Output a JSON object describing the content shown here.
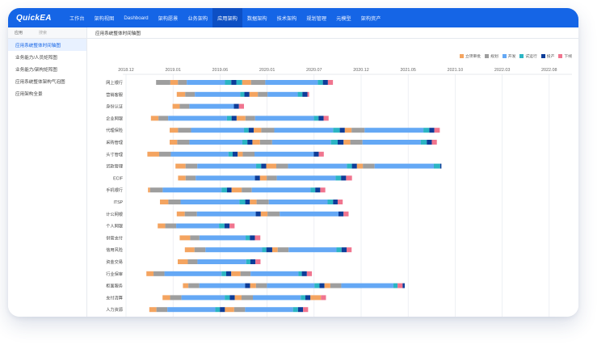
{
  "app": {
    "logo": "QuickEA"
  },
  "nav": {
    "items": [
      "工作台",
      "架构视图",
      "Dashboard",
      "架构愿景",
      "业务架构",
      "应用架构",
      "数据架构",
      "技术架构",
      "规划管理",
      "元模型",
      "架构资产"
    ],
    "active_index": 5
  },
  "sidebar": {
    "head_label": "应用",
    "head_search": "搜索",
    "items": [
      "应用系统整体时间轴图",
      "业务能力/人员矩阵图",
      "业务能力/架构矩阵图",
      "应用系统整体架构气泡图",
      "应用架构全景"
    ],
    "active_index": 0
  },
  "main": {
    "title": "应用系统整体时间轴图"
  },
  "colors": {
    "brand": "#1565e6",
    "nav_active": "#0d4fc4"
  },
  "chart_data": {
    "type": "gantt",
    "x_ticks": [
      "2018.12",
      "2019.01",
      "2019.06",
      "2020.01",
      "2020.07",
      "2020.12",
      "2021.05",
      "2021.10",
      "2022.03",
      "2022.08"
    ],
    "legend": [
      {
        "name": "立项审批",
        "color": "#f4a460"
      },
      {
        "name": "规划",
        "color": "#9e9e9e"
      },
      {
        "name": "开发",
        "color": "#64a8f5"
      },
      {
        "name": "试运行",
        "color": "#2bb5c4"
      },
      {
        "name": "投产",
        "color": "#0d3d99"
      },
      {
        "name": "下线",
        "color": "#f0758f"
      }
    ],
    "stage_colors": [
      "#f4a460",
      "#9e9e9e",
      "#64a8f5",
      "#2bb5c4",
      "#0d3d99",
      "#f0758f"
    ],
    "rows": [
      {
        "name": "网上银行",
        "segments": [
          [
            1,
            3.4
          ],
          [
            0,
            1.8
          ],
          [
            1,
            2.1
          ],
          [
            2,
            9.1
          ],
          [
            3,
            1.5
          ],
          [
            4,
            1.2
          ],
          [
            3,
            1.4
          ],
          [
            0,
            2.1
          ],
          [
            1,
            3.4
          ],
          [
            2,
            12.5
          ],
          [
            3,
            1.2
          ],
          [
            4,
            1.2
          ],
          [
            5,
            1.2
          ]
        ]
      },
      {
        "name": "营销客服",
        "segments": [
          [
            0,
            2.0
          ],
          [
            1,
            2.3
          ],
          [
            2,
            10.8
          ],
          [
            3,
            1.0
          ],
          [
            4,
            1.2
          ],
          [
            0,
            2.0
          ],
          [
            1,
            2.3
          ],
          [
            2,
            7.2
          ],
          [
            3,
            1.1
          ],
          [
            4,
            1.2
          ],
          [
            5,
            0.4
          ]
        ]
      },
      {
        "name": "身份认证",
        "segments": [
          [
            0,
            1.7
          ],
          [
            1,
            2.3
          ],
          [
            2,
            10.6
          ],
          [
            4,
            1.2
          ],
          [
            5,
            1.2
          ]
        ]
      },
      {
        "name": "企业网银",
        "segments": [
          [
            0,
            1.8
          ],
          [
            1,
            2.3
          ],
          [
            2,
            14.0
          ],
          [
            3,
            1.1
          ],
          [
            4,
            1.2
          ],
          [
            0,
            2.1
          ],
          [
            1,
            2.3
          ],
          [
            2,
            14.0
          ],
          [
            3,
            1.1
          ],
          [
            4,
            1.2
          ],
          [
            5,
            1.2
          ]
        ]
      },
      {
        "name": "代理保险",
        "segments": [
          [
            0,
            2.0
          ],
          [
            1,
            3.1
          ],
          [
            2,
            12.6
          ],
          [
            3,
            1.1
          ],
          [
            4,
            1.2
          ],
          [
            0,
            1.8
          ],
          [
            1,
            3.1
          ],
          [
            2,
            14.0
          ],
          [
            3,
            1.6
          ],
          [
            4,
            1.2
          ],
          [
            0,
            1.6
          ],
          [
            1,
            3.1
          ],
          [
            2,
            14.0
          ],
          [
            3,
            1.4
          ],
          [
            4,
            1.2
          ],
          [
            5,
            1.3
          ]
        ]
      },
      {
        "name": "采购管理",
        "segments": [
          [
            0,
            1.8
          ],
          [
            1,
            2.9
          ],
          [
            2,
            12.6
          ],
          [
            3,
            1.2
          ],
          [
            4,
            1.2
          ],
          [
            0,
            1.8
          ],
          [
            1,
            2.9
          ],
          [
            2,
            14.0
          ],
          [
            3,
            1.6
          ],
          [
            4,
            1.4
          ],
          [
            0,
            1.6
          ],
          [
            1,
            2.9
          ],
          [
            2,
            13.9
          ],
          [
            3,
            1.4
          ],
          [
            4,
            1.2
          ],
          [
            5,
            1.2
          ]
        ]
      },
      {
        "name": "头寸管理",
        "segments": [
          [
            0,
            2.8
          ],
          [
            1,
            2.8
          ],
          [
            2,
            13.7
          ],
          [
            3,
            1.0
          ],
          [
            4,
            1.2
          ],
          [
            0,
            1.2
          ],
          [
            1,
            2.8
          ],
          [
            2,
            14.1
          ],
          [
            4,
            1.2
          ],
          [
            5,
            1.2
          ]
        ]
      },
      {
        "name": "贷款管理",
        "segments": [
          [
            0,
            2.4
          ],
          [
            1,
            2.8
          ],
          [
            2,
            14.0
          ],
          [
            3,
            1.2
          ],
          [
            4,
            1.2
          ],
          [
            0,
            2.4
          ],
          [
            1,
            2.8
          ],
          [
            2,
            14.0
          ],
          [
            3,
            1.2
          ],
          [
            4,
            1.2
          ],
          [
            0,
            1.4
          ],
          [
            1,
            2.8
          ],
          [
            2,
            14.1
          ],
          [
            3,
            1.5
          ],
          [
            4,
            0.3
          ]
        ]
      },
      {
        "name": "ECIF",
        "segments": [
          [
            0,
            1.8
          ],
          [
            1,
            2.4
          ],
          [
            2,
            14.1
          ],
          [
            4,
            1.2
          ],
          [
            0,
            1.6
          ],
          [
            1,
            2.4
          ],
          [
            2,
            14.0
          ],
          [
            3,
            1.3
          ],
          [
            4,
            1.2
          ],
          [
            5,
            1.4
          ]
        ]
      },
      {
        "name": "手机银行",
        "segments": [
          [
            0,
            0.5
          ],
          [
            1,
            3.0
          ],
          [
            2,
            14.0
          ],
          [
            3,
            1.3
          ],
          [
            4,
            1.1
          ],
          [
            0,
            2.4
          ],
          [
            1,
            2.4
          ],
          [
            2,
            14.0
          ],
          [
            3,
            1.1
          ],
          [
            4,
            1.2
          ],
          [
            5,
            1.2
          ]
        ]
      },
      {
        "name": "ITSP",
        "segments": [
          [
            0,
            2.0
          ],
          [
            1,
            2.9
          ],
          [
            2,
            14.0
          ],
          [
            3,
            1.4
          ],
          [
            4,
            1.1
          ],
          [
            0,
            1.6
          ],
          [
            1,
            2.9
          ],
          [
            2,
            14.0
          ],
          [
            3,
            1.3
          ],
          [
            4,
            1.1
          ],
          [
            5,
            1.2
          ]
        ]
      },
      {
        "name": "计公网银",
        "segments": [
          [
            0,
            1.9
          ],
          [
            1,
            2.9
          ],
          [
            2,
            14.0
          ],
          [
            4,
            1.2
          ],
          [
            0,
            1.6
          ],
          [
            1,
            2.9
          ],
          [
            2,
            14.0
          ],
          [
            4,
            1.2
          ],
          [
            5,
            1.2
          ]
        ]
      },
      {
        "name": "个人网银",
        "segments": [
          [
            0,
            1.8
          ],
          [
            1,
            2.6
          ],
          [
            2,
            10.2
          ],
          [
            3,
            1.3
          ],
          [
            4,
            1.2
          ],
          [
            5,
            1.2
          ]
        ]
      },
      {
        "name": "供需支付",
        "segments": [
          [
            0,
            2.5
          ],
          [
            1,
            2.2
          ],
          [
            2,
            11.0
          ],
          [
            3,
            1.0
          ],
          [
            4,
            1.2
          ],
          [
            5,
            1.3
          ]
        ]
      },
      {
        "name": "信用风险",
        "segments": [
          [
            0,
            2.3
          ],
          [
            1,
            2.6
          ],
          [
            2,
            13.5
          ],
          [
            3,
            1.0
          ],
          [
            4,
            1.4
          ],
          [
            0,
            1.3
          ],
          [
            1,
            2.6
          ],
          [
            2,
            11.4
          ],
          [
            3,
            1.2
          ],
          [
            4,
            1.2
          ],
          [
            5,
            1.2
          ]
        ]
      },
      {
        "name": "资金交易",
        "segments": [
          [
            0,
            2.4
          ],
          [
            1,
            2.3
          ],
          [
            2,
            11.6
          ],
          [
            3,
            1.0
          ],
          [
            4,
            1.2
          ],
          [
            5,
            1.2
          ]
        ]
      },
      {
        "name": "行业保审",
        "segments": [
          [
            0,
            1.7
          ],
          [
            1,
            2.6
          ],
          [
            2,
            13.6
          ],
          [
            3,
            1.1
          ],
          [
            4,
            1.2
          ],
          [
            0,
            2.2
          ],
          [
            1,
            2.4
          ],
          [
            2,
            11.4
          ],
          [
            3,
            0.8
          ],
          [
            4,
            1.2
          ],
          [
            5,
            1.2
          ]
        ]
      },
      {
        "name": "柜面服务",
        "segments": [
          [
            0,
            1.3
          ],
          [
            1,
            2.6
          ],
          [
            2,
            10.9
          ],
          [
            4,
            1.2
          ],
          [
            0,
            1.4
          ],
          [
            1,
            2.6
          ],
          [
            2,
            11.3
          ],
          [
            3,
            1.2
          ],
          [
            4,
            1.2
          ],
          [
            0,
            1.4
          ],
          [
            1,
            2.6
          ],
          [
            2,
            12.4
          ],
          [
            3,
            1.0
          ],
          [
            5,
            1.2
          ],
          [
            4,
            0.5
          ]
        ]
      },
      {
        "name": "支付清算",
        "segments": [
          [
            0,
            1.8
          ],
          [
            1,
            2.7
          ],
          [
            2,
            10.3
          ],
          [
            3,
            1.2
          ],
          [
            4,
            1.2
          ],
          [
            0,
            1.6
          ],
          [
            1,
            2.7
          ],
          [
            2,
            11.4
          ],
          [
            3,
            1.1
          ],
          [
            4,
            1.2
          ],
          [
            0,
            2.5
          ],
          [
            5,
            1.2
          ]
        ]
      },
      {
        "name": "人力资源",
        "segments": [
          [
            0,
            1.7
          ],
          [
            1,
            2.6
          ],
          [
            2,
            11.4
          ],
          [
            3,
            1.1
          ],
          [
            4,
            1.2
          ],
          [
            0,
            2.2
          ],
          [
            1,
            2.6
          ],
          [
            2,
            11.4
          ],
          [
            3,
            1.2
          ],
          [
            4,
            1.2
          ],
          [
            5,
            1.2
          ]
        ]
      }
    ],
    "row_starts": [
      9.3,
      15.7,
      14.4,
      7.7,
      13.5,
      13.5,
      6.6,
      15.3,
      16.1,
      6.8,
      10.5,
      15.7,
      9.8,
      16.6,
      18.2,
      16.0,
      6.3,
      17.6,
      11.3,
      7.2
    ]
  }
}
